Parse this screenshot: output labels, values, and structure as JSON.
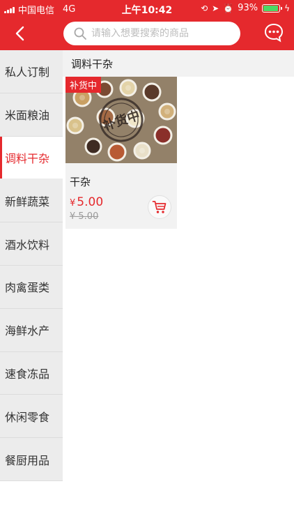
{
  "status_bar": {
    "carrier": "中国电信",
    "network": "4G",
    "time": "上午10:42",
    "battery": "93%",
    "battery_level": 0.93
  },
  "nav": {
    "search_placeholder": "请输入想要搜索的商品"
  },
  "sidebar": {
    "items": [
      {
        "label": "私人订制"
      },
      {
        "label": "米面粮油"
      },
      {
        "label": "调料干杂"
      },
      {
        "label": "新鲜蔬菜"
      },
      {
        "label": "酒水饮料"
      },
      {
        "label": "肉禽蛋类"
      },
      {
        "label": "海鲜水产"
      },
      {
        "label": "速食冻品"
      },
      {
        "label": "休闲零食"
      },
      {
        "label": "餐厨用品"
      }
    ],
    "active_index": 2
  },
  "content": {
    "section_title": "调料干杂",
    "products": [
      {
        "badge": "补货中",
        "name": "干杂",
        "currency": "¥",
        "price": "5.00",
        "old_price": "¥ 5.00"
      }
    ]
  },
  "colors": {
    "brand_red": "#e5292d",
    "sidebar_bg": "#ececec",
    "battery_green": "#4cd964"
  }
}
